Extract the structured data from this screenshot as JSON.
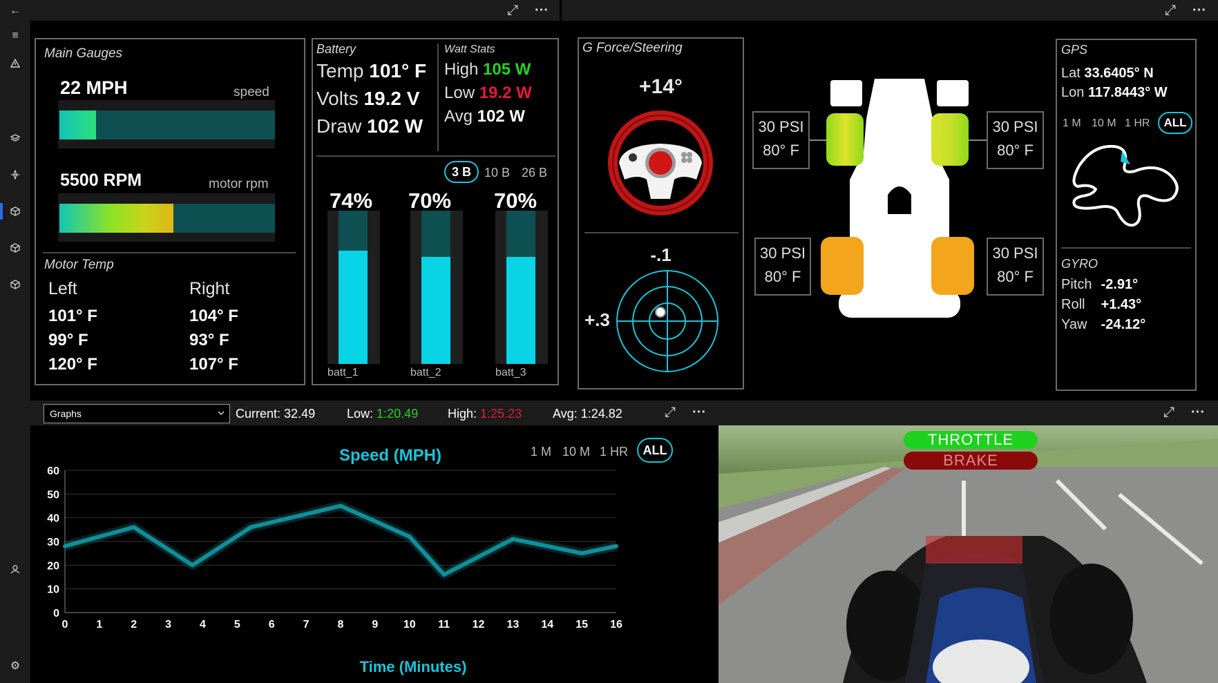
{
  "sidebar": {
    "icons": [
      "back-arrow-icon",
      "hamburger-icon",
      "warning-icon",
      "layers-icon",
      "compass-icon",
      "cube-icon",
      "cube-outline-icon",
      "cube-alt-icon",
      "user-icon",
      "gear-icon"
    ],
    "back_glyph": "←",
    "menu_glyph": "≡",
    "user_glyph": "⍝",
    "gear_glyph": "⚙"
  },
  "toolbar": {
    "expand_glyph": "⤢",
    "more_glyph": "···"
  },
  "main_gauges": {
    "title": "Main Gauges",
    "speed_value": "22 MPH",
    "speed_label": "speed",
    "speed_fraction": 0.17,
    "rpm_value": "5500 RPM",
    "rpm_label": "motor rpm",
    "rpm_fraction": 0.53,
    "motor_temp_title": "Motor Temp",
    "left_header": "Left",
    "right_header": "Right",
    "left": [
      "101° F",
      "99° F",
      "120° F"
    ],
    "right": [
      "104° F",
      "93° F",
      "107° F"
    ]
  },
  "battery": {
    "title": "Battery",
    "temp_label": "Temp",
    "temp_value": "101° F",
    "volts_label": "Volts",
    "volts_value": "19.2 V",
    "draw_label": "Draw",
    "draw_value": "102 W",
    "watt_title": "Watt Stats",
    "high_label": "High",
    "high_value": "105 W",
    "low_label": "Low",
    "low_value": "19.2 W",
    "avg_label": "Avg",
    "avg_value": "102 W",
    "tabs": [
      "3 B",
      "10 B",
      "26 B"
    ],
    "cells": [
      {
        "pct": "74%",
        "fraction": 0.74,
        "name": "batt_1"
      },
      {
        "pct": "70%",
        "fraction": 0.7,
        "name": "batt_2"
      },
      {
        "pct": "70%",
        "fraction": 0.7,
        "name": "batt_3"
      }
    ]
  },
  "gforce": {
    "title": "G Force/Steering",
    "steering": "+14°",
    "g_y": "-.1",
    "g_x": "+.3"
  },
  "tires": {
    "front_left": {
      "psi": "30 PSI",
      "temp": "80° F"
    },
    "front_right": {
      "psi": "30 PSI",
      "temp": "80° F"
    },
    "rear_left": {
      "psi": "30 PSI",
      "temp": "80° F"
    },
    "rear_right": {
      "psi": "30 PSI",
      "temp": "80° F"
    }
  },
  "gps": {
    "title": "GPS",
    "lat_label": "Lat",
    "lat_value": "33.6405° N",
    "lon_label": "Lon",
    "lon_value": "117.8443° W",
    "tabs": [
      "1 M",
      "10 M",
      "1 HR",
      "ALL"
    ],
    "gyro_title": "GYRO",
    "pitch_label": "Pitch",
    "pitch_value": "-2.91°",
    "roll_label": "Roll",
    "roll_value": "+1.43°",
    "yaw_label": "Yaw",
    "yaw_value": "-24.12°"
  },
  "laps": {
    "dropdown_value": "Graphs",
    "current_label": "Current:",
    "current_value": "32.49",
    "low_label": "Low:",
    "low_value": "1:20.49",
    "high_label": "High:",
    "high_value": "1:25.23",
    "avg_label": "Avg:",
    "avg_value": "1:24.82"
  },
  "graph": {
    "tabs": [
      "1 M",
      "10 M",
      "1 HR",
      "ALL"
    ]
  },
  "chart_data": {
    "type": "line",
    "title": "Speed (MPH)",
    "xlabel": "Time (Minutes)",
    "ylabel": "",
    "x": [
      0,
      2,
      3.7,
      5.4,
      8,
      10,
      11,
      13,
      15,
      16
    ],
    "values": [
      28,
      36,
      20,
      36,
      45,
      32,
      16,
      31,
      25,
      28
    ],
    "xlim": [
      0,
      16
    ],
    "ylim": [
      0,
      60
    ],
    "xticks": [
      "0",
      "1",
      "2",
      "3",
      "4",
      "5",
      "6",
      "7",
      "8",
      "9",
      "10",
      "11",
      "12",
      "13",
      "14",
      "15",
      "16"
    ],
    "yticks": [
      "0",
      "10",
      "20",
      "30",
      "40",
      "50",
      "60"
    ],
    "color": "#0f8f99",
    "grid": true
  },
  "video": {
    "throttle": "THROTTLE",
    "brake": "BRAKE",
    "throttle_color": "#1fd11f",
    "brake_color": "#8a0a0a"
  }
}
